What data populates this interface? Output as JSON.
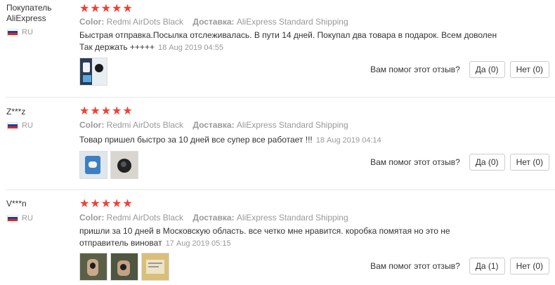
{
  "labels": {
    "color_key": "Color:",
    "shipping_key": "Доставка:",
    "helpful_question": "Вам помог этот отзыв?"
  },
  "reviews": [
    {
      "buyer": "Покупатель AliExpress",
      "country": "RU",
      "stars": "★★★★★",
      "color": "Redmi AirDots Black",
      "shipping": "AliExpress Standard Shipping",
      "text": "Быстрая отправка.Посылка отслеживалась. В пути 14 дней. Покупал два товара в подарок. Всем доволен Так держать +++++",
      "date": "18 Aug 2019 04:55",
      "yes": "Да (0)",
      "no": "Нет (0)",
      "thumbs": [
        "photo-box-thumb"
      ]
    },
    {
      "buyer": "Z***z",
      "country": "RU",
      "stars": "★★★★★",
      "color": "Redmi AirDots Black",
      "shipping": "AliExpress Standard Shipping",
      "text": "Товар пришел быстро за 10 дней все супер все работает !!!",
      "date": "18 Aug 2019 04:14",
      "yes": "Да (0)",
      "no": "Нет (0)",
      "thumbs": [
        "photo-box-thumb",
        "photo-earbuds-thumb"
      ]
    },
    {
      "buyer": "V***n",
      "country": "RU",
      "stars": "★★★★★",
      "color": "Redmi AirDots Black",
      "shipping": "AliExpress Standard Shipping",
      "text": "пришли за 10 дней в Московскую область. все четко мне нравится. коробка помятая но это не отправитель виноват",
      "date": "17 Aug 2019 05:15",
      "yes": "Да (1)",
      "no": "Нет (0)",
      "thumbs": [
        "photo-hand-thumb",
        "photo-hand-thumb",
        "photo-package-thumb"
      ]
    }
  ]
}
